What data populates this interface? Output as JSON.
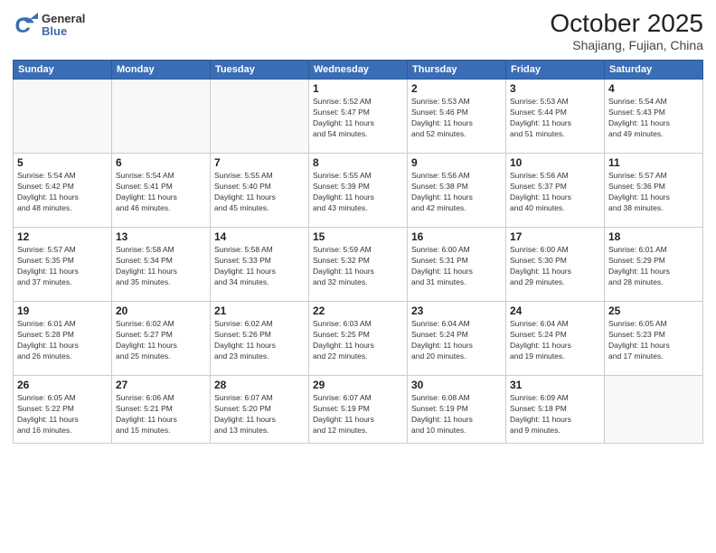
{
  "header": {
    "logo": {
      "general": "General",
      "blue": "Blue"
    },
    "title": "October 2025",
    "location": "Shajiang, Fujian, China"
  },
  "weekdays": [
    "Sunday",
    "Monday",
    "Tuesday",
    "Wednesday",
    "Thursday",
    "Friday",
    "Saturday"
  ],
  "weeks": [
    [
      {
        "day": "",
        "info": ""
      },
      {
        "day": "",
        "info": ""
      },
      {
        "day": "",
        "info": ""
      },
      {
        "day": "1",
        "info": "Sunrise: 5:52 AM\nSunset: 5:47 PM\nDaylight: 11 hours\nand 54 minutes."
      },
      {
        "day": "2",
        "info": "Sunrise: 5:53 AM\nSunset: 5:46 PM\nDaylight: 11 hours\nand 52 minutes."
      },
      {
        "day": "3",
        "info": "Sunrise: 5:53 AM\nSunset: 5:44 PM\nDaylight: 11 hours\nand 51 minutes."
      },
      {
        "day": "4",
        "info": "Sunrise: 5:54 AM\nSunset: 5:43 PM\nDaylight: 11 hours\nand 49 minutes."
      }
    ],
    [
      {
        "day": "5",
        "info": "Sunrise: 5:54 AM\nSunset: 5:42 PM\nDaylight: 11 hours\nand 48 minutes."
      },
      {
        "day": "6",
        "info": "Sunrise: 5:54 AM\nSunset: 5:41 PM\nDaylight: 11 hours\nand 46 minutes."
      },
      {
        "day": "7",
        "info": "Sunrise: 5:55 AM\nSunset: 5:40 PM\nDaylight: 11 hours\nand 45 minutes."
      },
      {
        "day": "8",
        "info": "Sunrise: 5:55 AM\nSunset: 5:39 PM\nDaylight: 11 hours\nand 43 minutes."
      },
      {
        "day": "9",
        "info": "Sunrise: 5:56 AM\nSunset: 5:38 PM\nDaylight: 11 hours\nand 42 minutes."
      },
      {
        "day": "10",
        "info": "Sunrise: 5:56 AM\nSunset: 5:37 PM\nDaylight: 11 hours\nand 40 minutes."
      },
      {
        "day": "11",
        "info": "Sunrise: 5:57 AM\nSunset: 5:36 PM\nDaylight: 11 hours\nand 38 minutes."
      }
    ],
    [
      {
        "day": "12",
        "info": "Sunrise: 5:57 AM\nSunset: 5:35 PM\nDaylight: 11 hours\nand 37 minutes."
      },
      {
        "day": "13",
        "info": "Sunrise: 5:58 AM\nSunset: 5:34 PM\nDaylight: 11 hours\nand 35 minutes."
      },
      {
        "day": "14",
        "info": "Sunrise: 5:58 AM\nSunset: 5:33 PM\nDaylight: 11 hours\nand 34 minutes."
      },
      {
        "day": "15",
        "info": "Sunrise: 5:59 AM\nSunset: 5:32 PM\nDaylight: 11 hours\nand 32 minutes."
      },
      {
        "day": "16",
        "info": "Sunrise: 6:00 AM\nSunset: 5:31 PM\nDaylight: 11 hours\nand 31 minutes."
      },
      {
        "day": "17",
        "info": "Sunrise: 6:00 AM\nSunset: 5:30 PM\nDaylight: 11 hours\nand 29 minutes."
      },
      {
        "day": "18",
        "info": "Sunrise: 6:01 AM\nSunset: 5:29 PM\nDaylight: 11 hours\nand 28 minutes."
      }
    ],
    [
      {
        "day": "19",
        "info": "Sunrise: 6:01 AM\nSunset: 5:28 PM\nDaylight: 11 hours\nand 26 minutes."
      },
      {
        "day": "20",
        "info": "Sunrise: 6:02 AM\nSunset: 5:27 PM\nDaylight: 11 hours\nand 25 minutes."
      },
      {
        "day": "21",
        "info": "Sunrise: 6:02 AM\nSunset: 5:26 PM\nDaylight: 11 hours\nand 23 minutes."
      },
      {
        "day": "22",
        "info": "Sunrise: 6:03 AM\nSunset: 5:25 PM\nDaylight: 11 hours\nand 22 minutes."
      },
      {
        "day": "23",
        "info": "Sunrise: 6:04 AM\nSunset: 5:24 PM\nDaylight: 11 hours\nand 20 minutes."
      },
      {
        "day": "24",
        "info": "Sunrise: 6:04 AM\nSunset: 5:24 PM\nDaylight: 11 hours\nand 19 minutes."
      },
      {
        "day": "25",
        "info": "Sunrise: 6:05 AM\nSunset: 5:23 PM\nDaylight: 11 hours\nand 17 minutes."
      }
    ],
    [
      {
        "day": "26",
        "info": "Sunrise: 6:05 AM\nSunset: 5:22 PM\nDaylight: 11 hours\nand 16 minutes."
      },
      {
        "day": "27",
        "info": "Sunrise: 6:06 AM\nSunset: 5:21 PM\nDaylight: 11 hours\nand 15 minutes."
      },
      {
        "day": "28",
        "info": "Sunrise: 6:07 AM\nSunset: 5:20 PM\nDaylight: 11 hours\nand 13 minutes."
      },
      {
        "day": "29",
        "info": "Sunrise: 6:07 AM\nSunset: 5:19 PM\nDaylight: 11 hours\nand 12 minutes."
      },
      {
        "day": "30",
        "info": "Sunrise: 6:08 AM\nSunset: 5:19 PM\nDaylight: 11 hours\nand 10 minutes."
      },
      {
        "day": "31",
        "info": "Sunrise: 6:09 AM\nSunset: 5:18 PM\nDaylight: 11 hours\nand 9 minutes."
      },
      {
        "day": "",
        "info": ""
      }
    ]
  ]
}
